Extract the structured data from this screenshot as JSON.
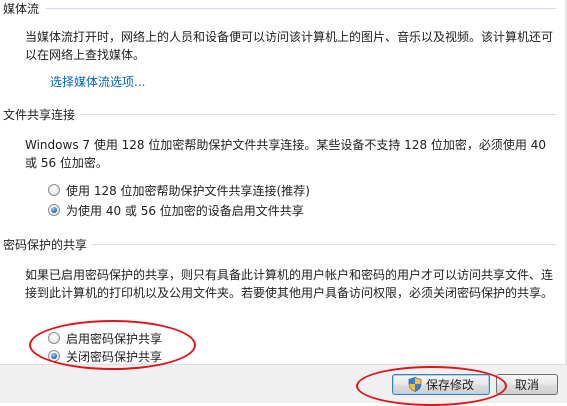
{
  "media": {
    "title": "媒体流",
    "description": "当媒体流打开时，网络上的人员和设备便可以访问该计算机上的图片、音乐以及视频。该计算机还可以在网络上查找媒体。",
    "link": "选择媒体流选项..."
  },
  "file_sharing": {
    "title": "文件共享连接",
    "description": "Windows 7 使用 128 位加密帮助保护文件共享连接。某些设备不支持 128 位加密，必须使用 40 或 56 位加密。",
    "options": [
      {
        "label": "使用 128 位加密帮助保护文件共享连接(推荐)",
        "checked": false
      },
      {
        "label": "为使用 40 或 56 位加密的设备启用文件共享",
        "checked": true
      }
    ]
  },
  "password_sharing": {
    "title": "密码保护的共享",
    "description": "如果已启用密码保护的共享，则只有具备此计算机的用户帐户和密码的用户才可以访问共享文件、连接到此计算机的打印机以及公用文件夹。若要使其他用户具备访问权限，必须关闭密码保护的共享。",
    "options": [
      {
        "label": "启用密码保护共享",
        "checked": false
      },
      {
        "label": "关闭密码保护共享",
        "checked": true
      }
    ]
  },
  "footer": {
    "save_label": "保存修改",
    "cancel_label": "取消",
    "save_icon": "uac-shield-icon"
  },
  "colors": {
    "link": "#0066cc",
    "annotation": "#e0131a"
  }
}
